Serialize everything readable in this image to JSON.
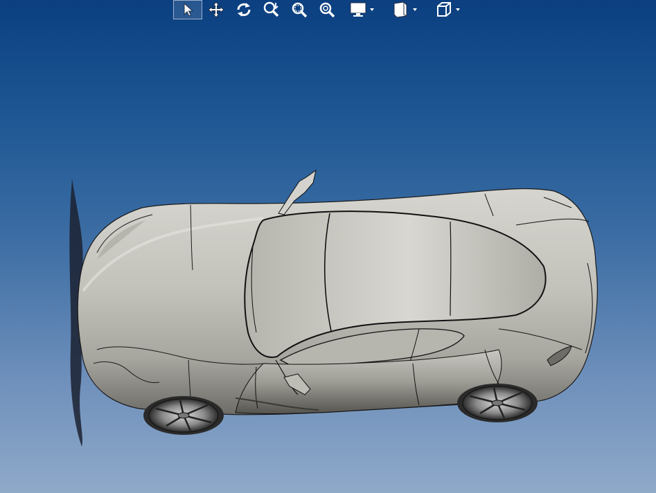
{
  "window": {
    "background_top": "#0b3f80",
    "background_bottom": "#8fa9c9"
  },
  "toolbar": {
    "tools": [
      {
        "icon": "select-arrow-icon",
        "active": true
      },
      {
        "icon": "pan-move-icon",
        "active": false
      },
      {
        "icon": "rotate-icon",
        "active": false
      },
      {
        "icon": "zoom-dynamic-icon",
        "active": false
      },
      {
        "icon": "zoom-window-icon",
        "active": false
      },
      {
        "icon": "zoom-fit-icon",
        "active": false
      },
      {
        "icon": "display-mode-icon",
        "active": false,
        "has_dropdown": true
      },
      {
        "icon": "section-view-icon",
        "active": false,
        "has_dropdown": true
      },
      {
        "icon": "view-orientation-icon",
        "active": false,
        "has_dropdown": true
      }
    ]
  },
  "model": {
    "name_icon": "sports-car-model",
    "body_color": "#c9c8c2",
    "edge_color": "#111111",
    "shadow_color": "#1a1f2a"
  }
}
